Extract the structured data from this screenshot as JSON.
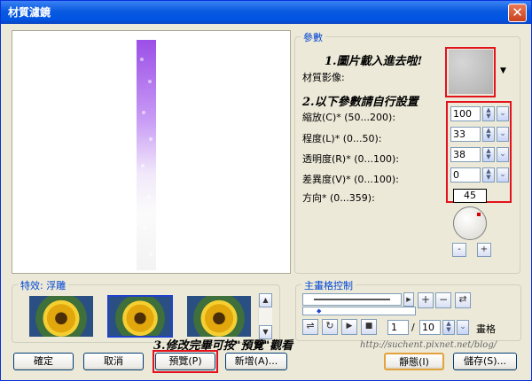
{
  "window": {
    "title": "材質濾鏡",
    "close_glyph": "✕"
  },
  "params": {
    "group_title": "參數",
    "texture_label": "材質影像:",
    "rows": [
      {
        "label": "縮放(C)* (50...200):",
        "value": "100"
      },
      {
        "label": "程度(L)* (0...50):",
        "value": "33"
      },
      {
        "label": "透明度(R)* (0...100):",
        "value": "38"
      },
      {
        "label": "差異度(V)* (0...100):",
        "value": "0"
      }
    ],
    "direction_label": "方向* (0...359):",
    "direction_value": "45",
    "dial_minus": "-",
    "dial_plus": "+"
  },
  "annotations": {
    "step1": "1.圖片載入進去啦!",
    "step2": "2.以下參數請自行設置",
    "step3": "3.修改完畢可按\"預覽\"觀看"
  },
  "effects": {
    "group_title": "特效: 浮雕"
  },
  "keyframe": {
    "group_title": "主畫格控制",
    "frame_value": "1",
    "separator": "/",
    "total_value": "10",
    "frames_label": "畫格"
  },
  "watermark": "http://suchent.pixnet.net/blog/",
  "buttons": {
    "ok": "確定",
    "cancel": "取消",
    "preview": "預覽(P)",
    "new": "新增(A)...",
    "silent": "靜態(I)",
    "save": "儲存(S)..."
  },
  "colors": {
    "annotation_box": "#e3121d",
    "title_bar": "#0054e3"
  }
}
